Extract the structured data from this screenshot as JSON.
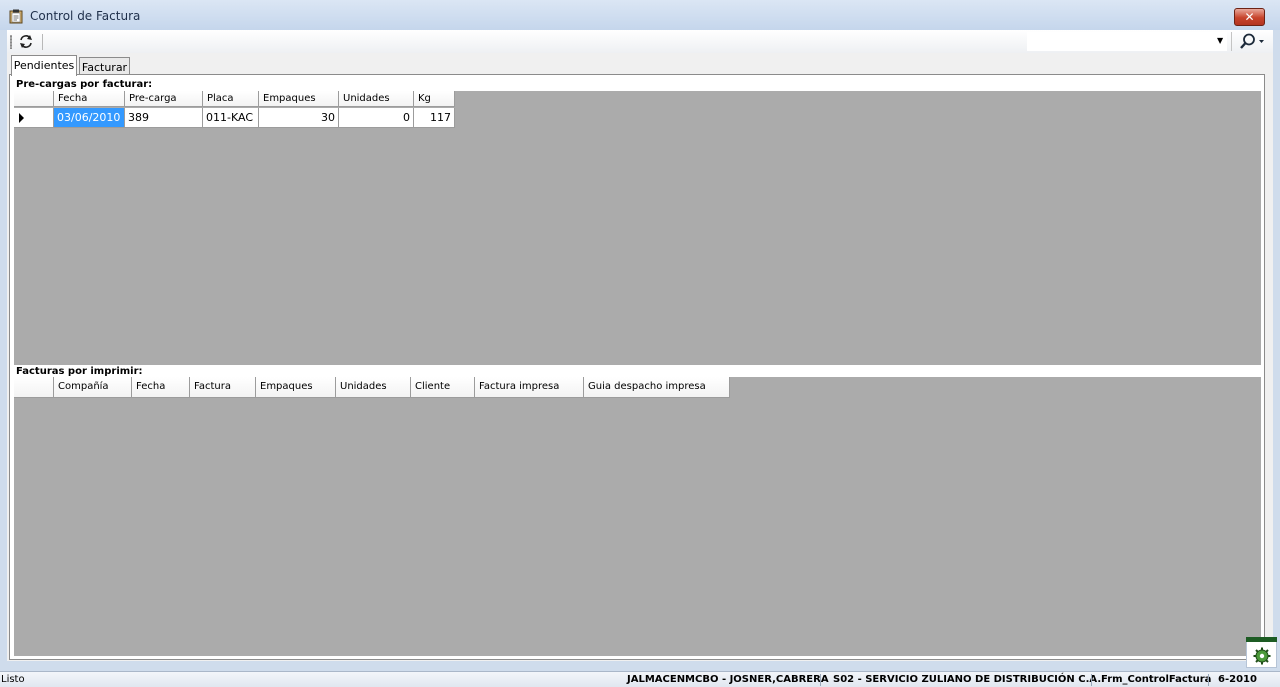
{
  "window": {
    "title": "Control de Factura",
    "close_label": "✕"
  },
  "tabs": [
    {
      "label": "Pendientes"
    },
    {
      "label": "Facturar"
    }
  ],
  "precargas": {
    "label": "Pre-cargas por facturar:",
    "columns": [
      "Fecha",
      "Pre-carga",
      "Placa",
      "Empaques",
      "Unidades",
      "Kg"
    ],
    "rows": [
      {
        "fecha": "03/06/2010",
        "precarga": "389",
        "placa": "011-KAC",
        "empaques": "30",
        "unidades": "0",
        "kg": "117"
      }
    ]
  },
  "facturas": {
    "label": "Facturas por imprimir:",
    "columns": [
      "Compañía",
      "Fecha",
      "Factura",
      "Empaques",
      "Unidades",
      "Cliente",
      "Factura impresa",
      "Guia despacho impresa"
    ]
  },
  "status": {
    "state": "Listo",
    "user": "JALMACENMCBO - JOSNER,CABRERA",
    "company": "S02 - SERVICIO ZULIANO DE DISTRIBUCIÓN C.A.",
    "form": "Frm_ControlFactura",
    "period": "6-2010"
  }
}
